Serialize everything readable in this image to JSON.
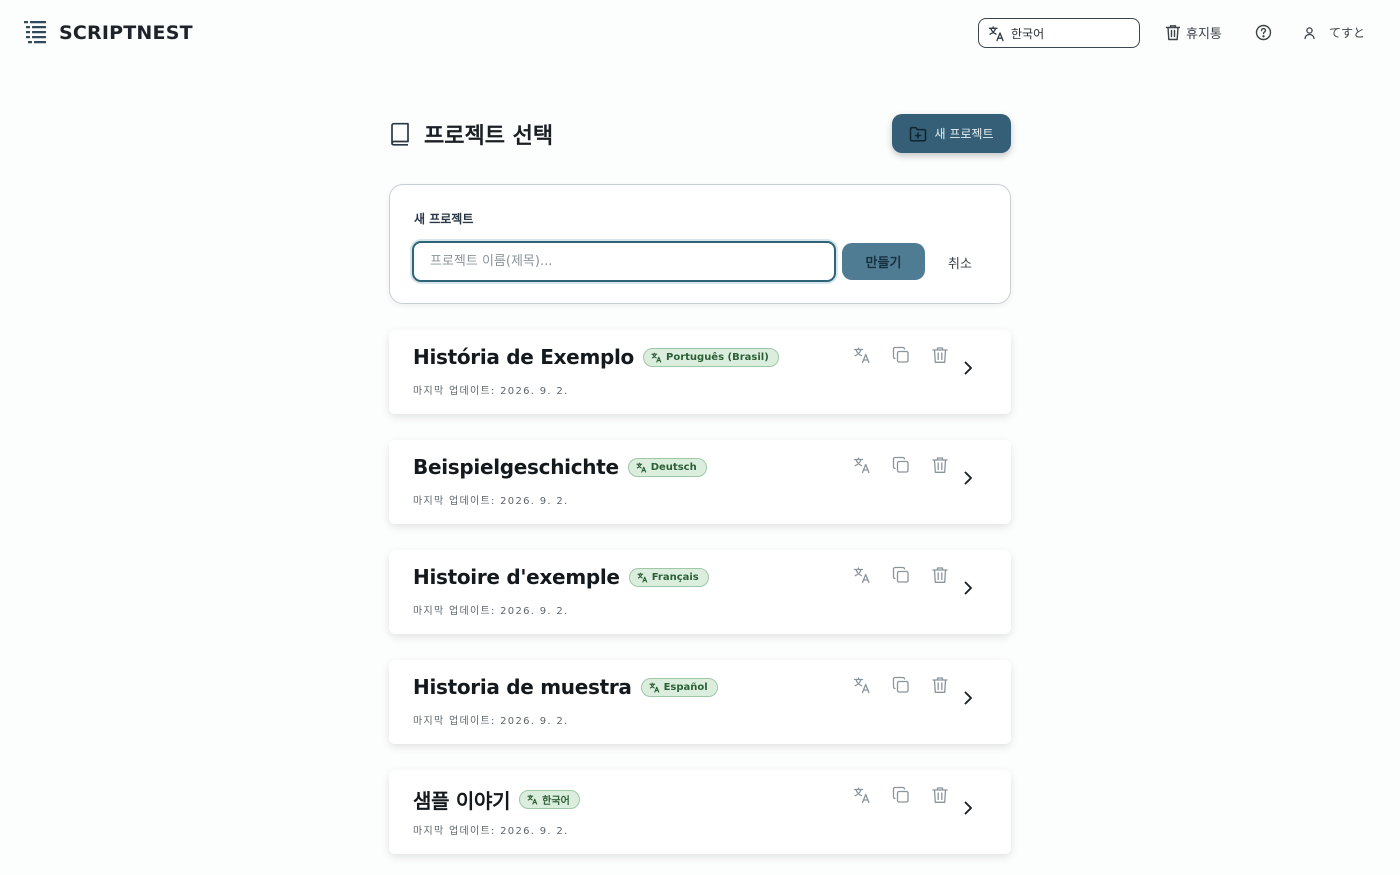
{
  "header": {
    "brand_name": "SCRIPTNEST",
    "language_selected": "한국어",
    "trash_label": "휴지통",
    "user_name": "てすと"
  },
  "main": {
    "page_title": "프로젝트 선택",
    "new_project_button": "새 프로젝트",
    "create_form": {
      "label": "새 프로젝트",
      "input_value": "",
      "input_placeholder": "프로젝트 이름(제목)...",
      "create_button": "만들기",
      "cancel_button": "취소"
    },
    "projects": [
      {
        "name": "História de Exemplo",
        "language": "Português (Brasil)",
        "updated": "마지막 업데이트: 2026. 9. 2."
      },
      {
        "name": "Beispielgeschichte",
        "language": "Deutsch",
        "updated": "마지막 업데이트: 2026. 9. 2."
      },
      {
        "name": "Histoire d'exemple",
        "language": "Français",
        "updated": "마지막 업데이트: 2026. 9. 2."
      },
      {
        "name": "Historia de muestra",
        "language": "Español",
        "updated": "마지막 업데이트: 2026. 9. 2."
      },
      {
        "name": "샘플 이야기",
        "language": "한국어",
        "updated": "마지막 업데이트: 2026. 9. 2."
      }
    ]
  },
  "icons": {
    "brand": "script-list-icon",
    "language": "translate-icon",
    "trash": "trash-icon",
    "help": "help-circle-icon",
    "user": "user-icon",
    "page_title": "book-icon",
    "new_project": "folder-plus-icon",
    "card_actions": [
      "translate-icon",
      "copy-icon",
      "trash-icon"
    ],
    "card_open": "chevron-right-icon"
  },
  "colors": {
    "primary": "#345f76",
    "primary_light": "#4f7c92",
    "badge_bg": "#dbeede",
    "badge_text": "#2c5f36",
    "background": "#fcfdfd"
  }
}
